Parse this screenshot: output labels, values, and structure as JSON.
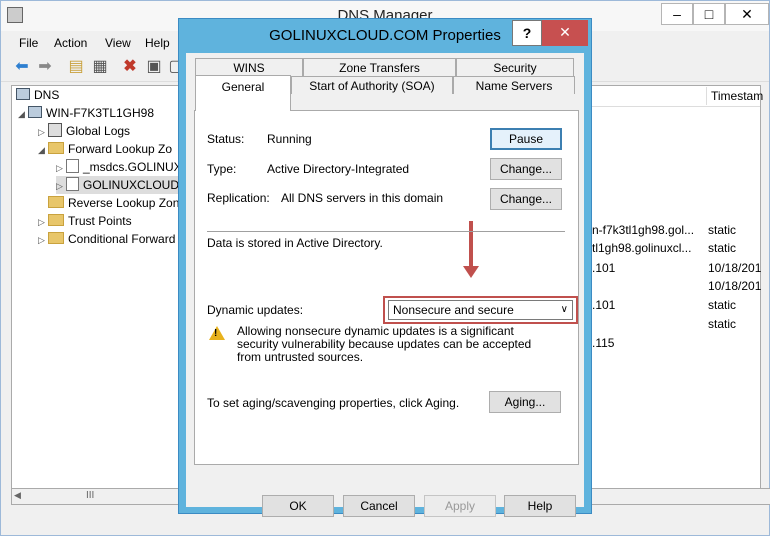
{
  "main": {
    "title": "DNS Manager",
    "minimize": "–",
    "maximize": "□",
    "close": "✕",
    "menu": [
      "File",
      "Action",
      "View",
      "Help"
    ],
    "tree": {
      "root": "DNS",
      "server": "WIN-F7K3TL1GH98",
      "global_logs": "Global Logs",
      "forward": "Forward Lookup Zo",
      "msdcs": "_msdcs.GOLINUX",
      "zone": "GOLINUXCLOUD",
      "reverse": "Reverse Lookup Zon",
      "trust": "Trust Points",
      "conditional": "Conditional Forward"
    },
    "hscroll_thumb": "III",
    "columns": {
      "timestamp": "Timestam"
    },
    "rows": [
      {
        "data": "n-f7k3tl1gh98.gol...",
        "ts": "static"
      },
      {
        "data": "tl1gh98.golinuxcl...",
        "ts": "static"
      },
      {
        "data": ".101",
        "ts": "10/18/201"
      },
      {
        "data": "",
        "ts": "10/18/201"
      },
      {
        "data": ".101",
        "ts": "static"
      },
      {
        "data": "",
        "ts": "static"
      },
      {
        "data": ".115",
        "ts": ""
      }
    ]
  },
  "dialog": {
    "title": "GOLINUXCLOUD.COM Properties",
    "help": "?",
    "close": "✕",
    "tabs_top": [
      "WINS",
      "Zone Transfers",
      "Security"
    ],
    "tabs_bottom": [
      "General",
      "Start of Authority (SOA)",
      "Name Servers"
    ],
    "status_label": "Status:",
    "status_value": "Running",
    "pause": "Pause",
    "type_label": "Type:",
    "type_value": "Active Directory-Integrated",
    "change1": "Change...",
    "replication_label": "Replication:",
    "replication_value": "All DNS servers in this domain",
    "change2": "Change...",
    "stored_text": "Data is stored in Active Directory.",
    "dyn_label": "Dynamic updates:",
    "dyn_value": "Nonsecure and secure",
    "warning": "Allowing nonsecure dynamic updates is a significant security vulnerability because updates can be accepted from untrusted sources.",
    "aging_text": "To set aging/scavenging properties, click Aging.",
    "aging": "Aging...",
    "ok": "OK",
    "cancel": "Cancel",
    "apply": "Apply",
    "help_btn": "Help"
  },
  "colors": {
    "dialog_frame": "#5fb3dd",
    "highlight": "#c0504d",
    "close": "#c75050"
  }
}
